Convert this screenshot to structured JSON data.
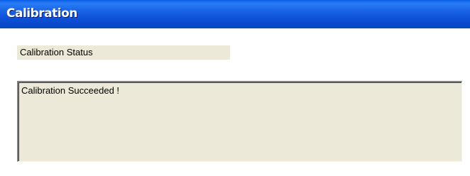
{
  "window": {
    "title": "Calibration"
  },
  "status": {
    "label": "Calibration Status",
    "message": "Calibration Succeeded !"
  },
  "colors": {
    "title_bar": "#0d50d8",
    "panel_background": "#ece9d8"
  }
}
